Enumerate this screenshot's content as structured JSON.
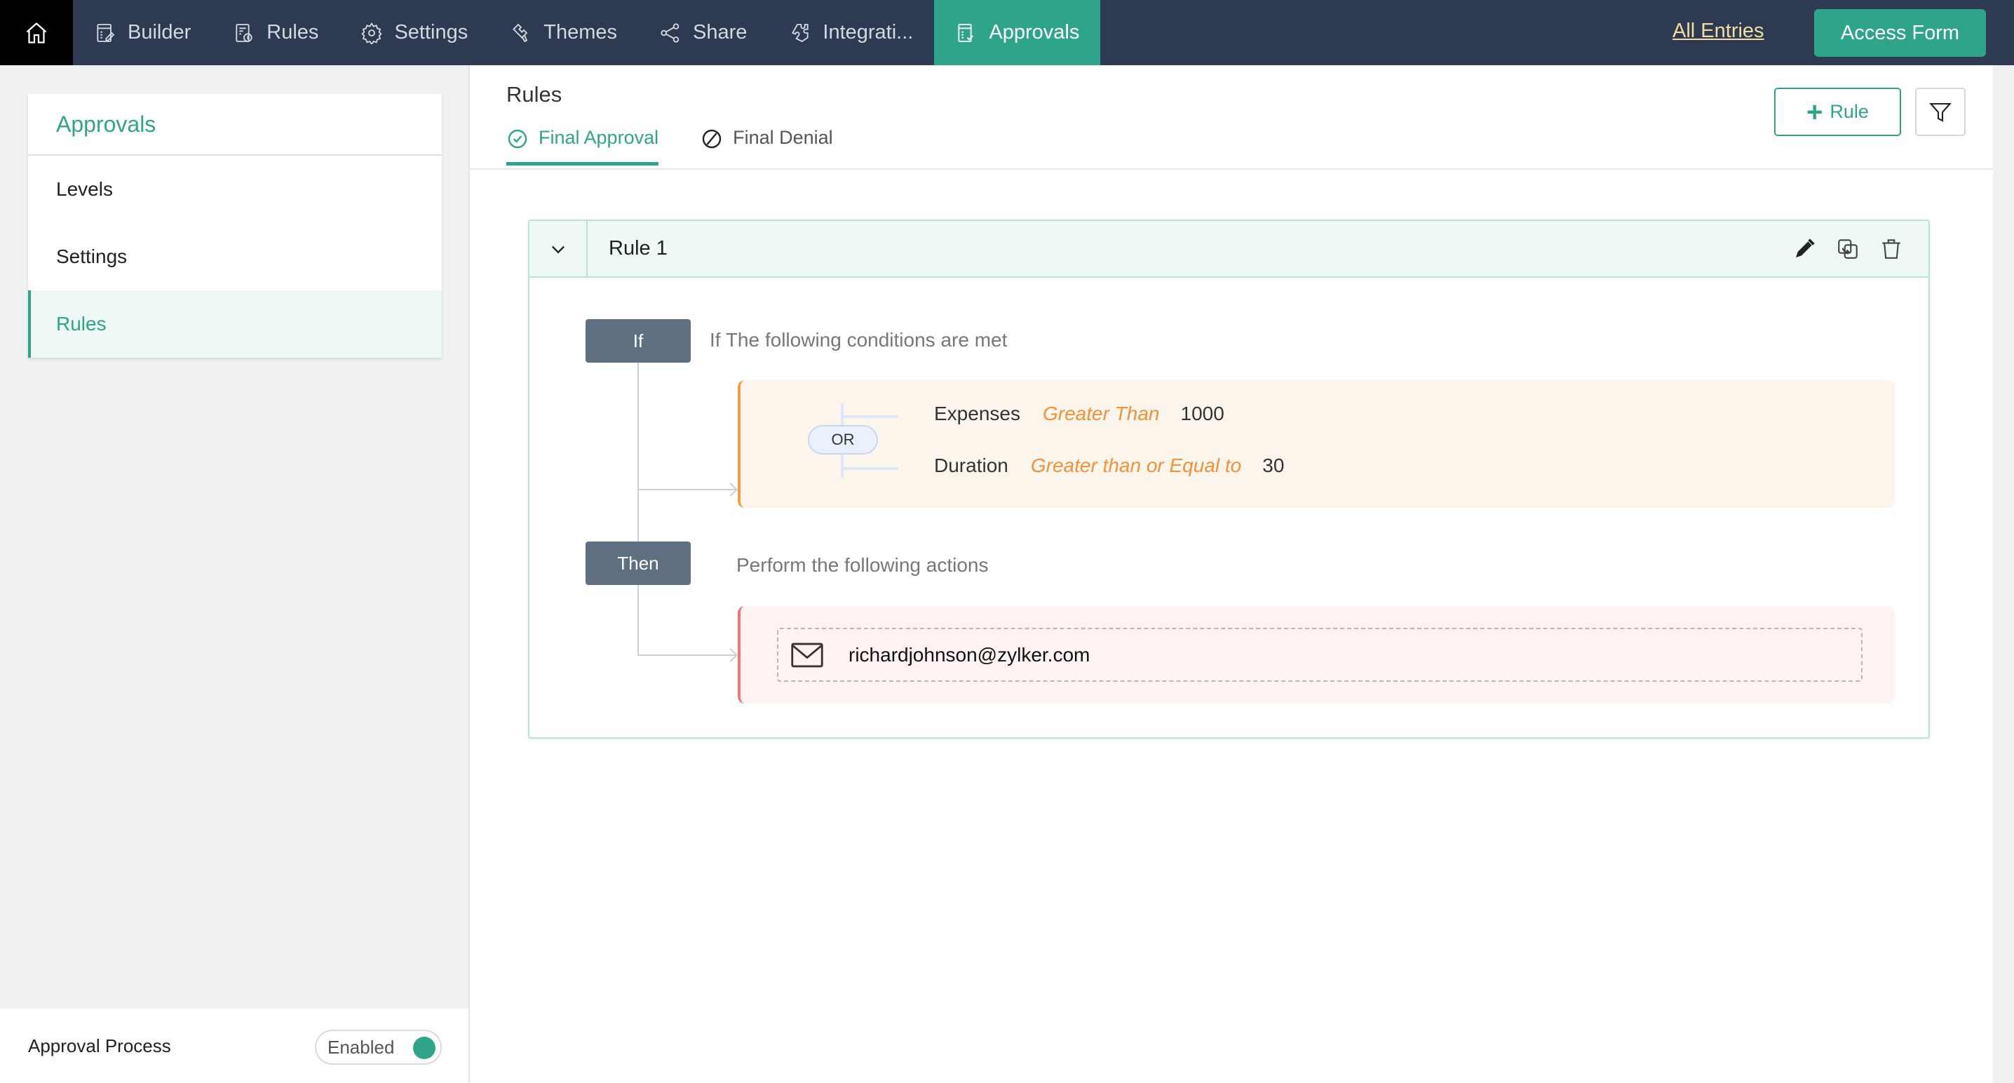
{
  "topbar": {
    "home_icon": "home-icon",
    "nav": [
      {
        "label": "Builder",
        "icon": "builder-form-icon",
        "active": false
      },
      {
        "label": "Rules",
        "icon": "rules-icon",
        "active": false
      },
      {
        "label": "Settings",
        "icon": "gear-icon",
        "active": false
      },
      {
        "label": "Themes",
        "icon": "paint-brush-icon",
        "active": false
      },
      {
        "label": "Share",
        "icon": "share-icon",
        "active": false
      },
      {
        "label": "Integrati...",
        "icon": "puzzle-icon",
        "active": false
      },
      {
        "label": "Approvals",
        "icon": "approvals-icon",
        "active": true
      }
    ],
    "all_entries": "All Entries",
    "access_form": "Access Form",
    "accent_color": "#2ea58a",
    "bar_color": "#2e3a51"
  },
  "sidebar": {
    "title": "Approvals",
    "items": [
      {
        "label": "Levels",
        "active": false
      },
      {
        "label": "Settings",
        "active": false
      },
      {
        "label": "Rules",
        "active": true
      }
    ],
    "footer": {
      "label": "Approval Process",
      "toggle_label": "Enabled",
      "toggle_on": true
    }
  },
  "main": {
    "title": "Rules",
    "tabs": [
      {
        "label": "Final Approval",
        "icon": "check-circle-icon",
        "active": true
      },
      {
        "label": "Final Denial",
        "icon": "prohibited-icon",
        "active": false
      }
    ],
    "add_rule_label": "Rule",
    "filter_icon": "filter-icon",
    "rule": {
      "title": "Rule 1",
      "actions": [
        "edit-icon",
        "duplicate-icon",
        "delete-icon"
      ],
      "if_label": "If",
      "if_text": "If The following conditions are met",
      "operator": "OR",
      "conditions": [
        {
          "field": "Expenses",
          "op": "Greater Than",
          "value": "1000"
        },
        {
          "field": "Duration",
          "op": "Greater than or Equal to",
          "value": "30"
        }
      ],
      "then_label": "Then",
      "then_text": "Perform the following actions",
      "action_email": "richardjohnson@zylker.com"
    }
  }
}
